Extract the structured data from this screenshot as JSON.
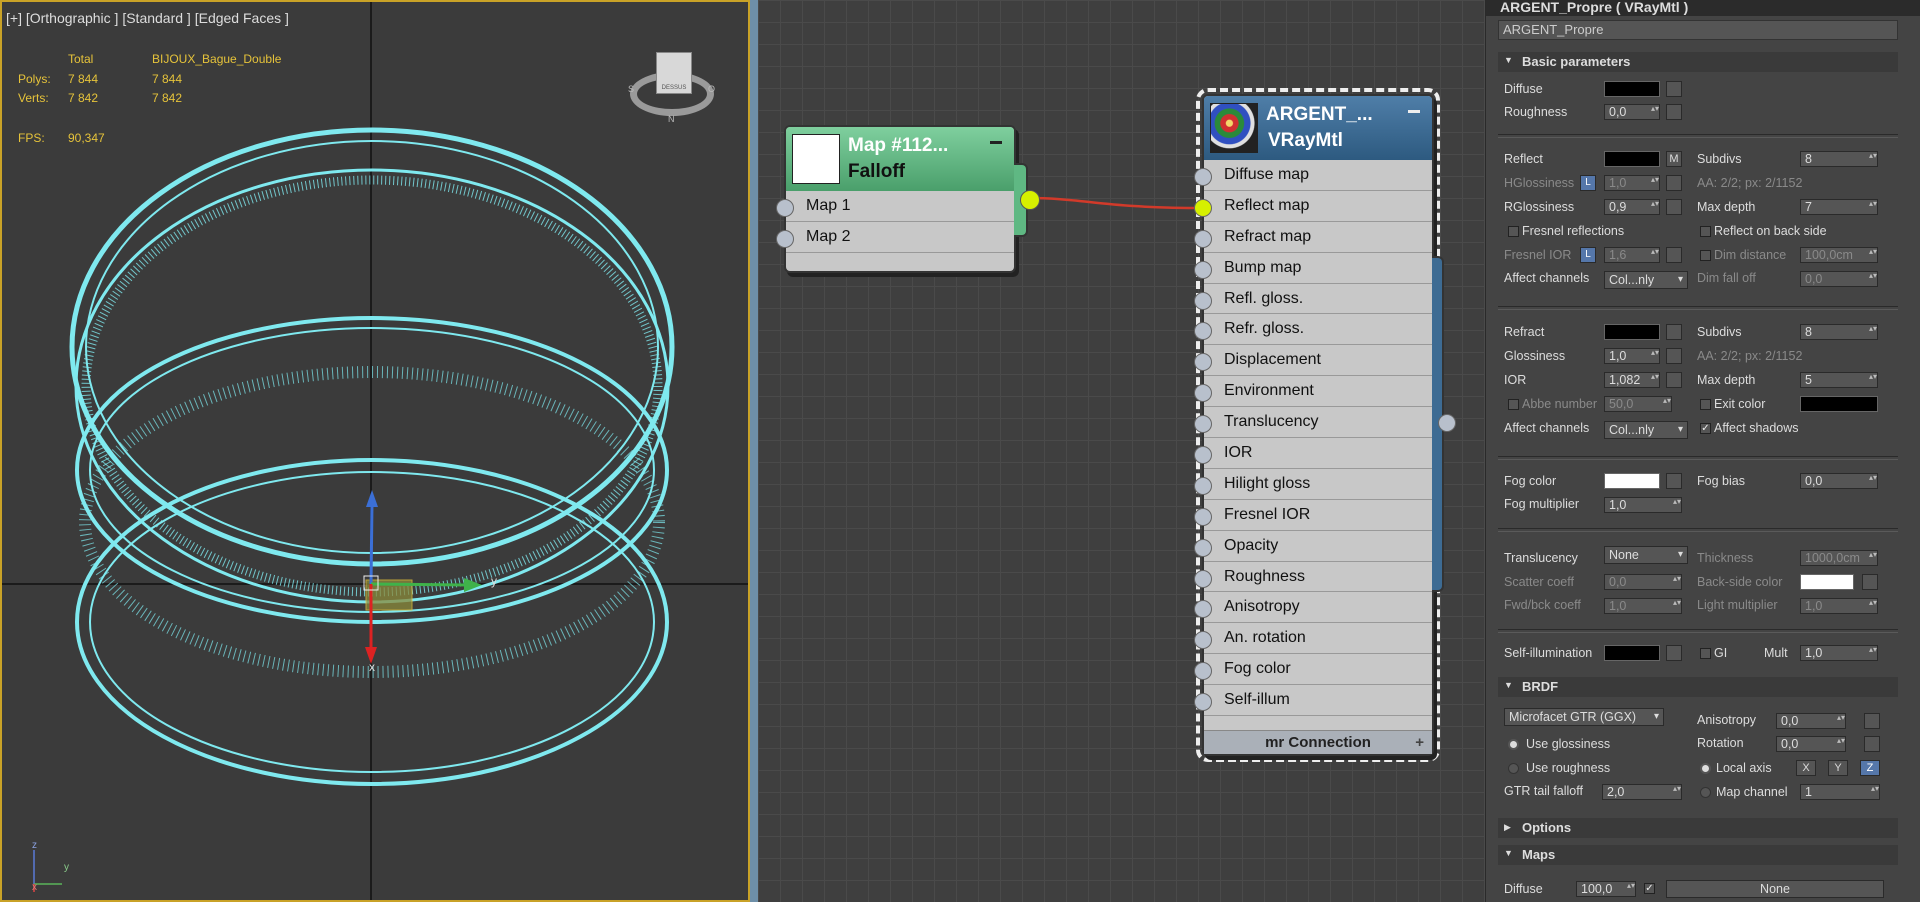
{
  "viewport": {
    "label": "[+] [Orthographic ] [Standard ] [Edged Faces ]",
    "stats_total": "Total",
    "stats_object": "BIJOUX_Bague_Double",
    "polys_label": "Polys:",
    "polys_total": "7 844",
    "polys_object": "7 844",
    "verts_label": "Verts:",
    "verts_total": "7 842",
    "verts_object": "7 842",
    "fps_label": "FPS:",
    "fps_value": "90,347",
    "axis_y": "y",
    "axis_x": "x",
    "axis_z": "z"
  },
  "viewcube": {
    "face": "DESSUS",
    "compass_left": "S",
    "compass_right": "O",
    "compass_bottom": "N"
  },
  "node_falloff": {
    "title": "Map #112...",
    "subtitle": "Falloff",
    "inputs": [
      "Map 1",
      "Map 2"
    ]
  },
  "node_vray": {
    "title": "ARGENT_...",
    "subtitle": "VRayMtl",
    "inputs": [
      "Diffuse map",
      "Reflect map",
      "Refract map",
      "Bump map",
      "Refl. gloss.",
      "Refr. gloss.",
      "Displacement",
      "Environment",
      "Translucency",
      "IOR",
      "Hilight gloss",
      "Fresnel IOR",
      "Opacity",
      "Roughness",
      "Anisotropy",
      "An. rotation",
      "Fog color",
      "Self-illum"
    ],
    "footer": "mr Connection"
  },
  "panel": {
    "title": "ARGENT_Propre  ( VRayMtl )",
    "name": "ARGENT_Propre",
    "basic_header": "Basic parameters",
    "diffuse": "Diffuse",
    "roughness": "Roughness",
    "roughness_val": "0,0",
    "reflect": "Reflect",
    "reflect_m": "M",
    "subdivs": "Subdivs",
    "refl_subdivs": "8",
    "hgloss": "HGlossiness",
    "hgloss_lock": "L",
    "hgloss_val": "1,0",
    "aa1": "AA: 2/2; px: 2/1152",
    "rgloss": "RGlossiness",
    "rgloss_val": "0,9",
    "maxdepth": "Max depth",
    "refl_maxdepth": "7",
    "fresnel": "Fresnel reflections",
    "backside": "Reflect on back side",
    "fresnel_ior": "Fresnel IOR",
    "fior_lock": "L",
    "fior_val": "1,6",
    "dimdist": "Dim distance",
    "dimdist_val": "100,0cm",
    "affect": "Affect channels",
    "affect_val": "Col...nly",
    "dimfall": "Dim fall off",
    "dimfall_val": "0,0",
    "refract": "Refract",
    "refr_subdivs": "8",
    "glossiness": "Glossiness",
    "refr_gloss": "1,0",
    "aa2": "AA: 2/2; px: 2/1152",
    "ior": "IOR",
    "ior_val": "1,082",
    "refr_maxdepth": "5",
    "abbe": "Abbe number",
    "abbe_val": "50,0",
    "exitcolor": "Exit color",
    "affect2_val": "Col...nly",
    "affect_shadows": "Affect shadows",
    "fogcolor": "Fog color",
    "fogbias": "Fog bias",
    "fogbias_val": "0,0",
    "fogmult": "Fog multiplier",
    "fogmult_val": "1,0",
    "translucency": "Translucency",
    "transl_val": "None",
    "thickness": "Thickness",
    "thickness_val": "1000,0cm",
    "scatter": "Scatter coeff",
    "scatter_val": "0,0",
    "backcolor": "Back-side color",
    "fwdbck": "Fwd/bck coeff",
    "fwdbck_val": "1,0",
    "lightmult": "Light multiplier",
    "lightmult_val": "1,0",
    "selfillum": "Self-illumination",
    "gi": "GI",
    "mult": "Mult",
    "mult_val": "1,0",
    "brdf_header": "BRDF",
    "brdf_type": "Microfacet GTR (GGX)",
    "anisotropy": "Anisotropy",
    "aniso_val": "0,0",
    "use_gloss": "Use glossiness",
    "rotation": "Rotation",
    "rot_val": "0,0",
    "use_rough": "Use roughness",
    "local_axis": "Local axis",
    "ax_x": "X",
    "ax_y": "Y",
    "ax_z": "Z",
    "gtr": "GTR tail falloff",
    "gtr_val": "2,0",
    "mapchannel": "Map channel",
    "mapchannel_val": "1",
    "options_header": "Options",
    "maps_header": "Maps",
    "maps_diffuse": "Diffuse",
    "maps_diffuse_val": "100,0",
    "maps_none": "None"
  },
  "colors": {
    "viewport_border": "#c9a227",
    "wire": "#7fe9ef",
    "falloff_head": "#5fb883",
    "vray_head": "#3d6b93",
    "wire_link": "#d23a2a",
    "socket_active": "#d6f000"
  }
}
